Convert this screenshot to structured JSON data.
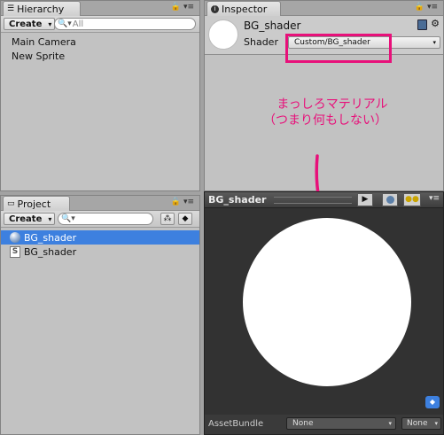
{
  "hierarchy": {
    "tab_label": "Hierarchy",
    "create_label": "Create",
    "search_placeholder": "All",
    "items": [
      "Main Camera",
      "New Sprite"
    ]
  },
  "project": {
    "tab_label": "Project",
    "create_label": "Create",
    "items": [
      {
        "label": "BG_shader",
        "icon": "material-sphere-icon",
        "selected": true
      },
      {
        "label": "BG_shader",
        "icon": "shader-file-icon",
        "selected": false
      }
    ]
  },
  "inspector": {
    "tab_label": "Inspector",
    "object_name": "BG_shader",
    "shader_label": "Shader",
    "shader_value": "Custom/BG_shader"
  },
  "annotation": {
    "line1": "まっしろマテリアル",
    "line2": "（つまり何もしない）",
    "color": "#e8107a"
  },
  "preview": {
    "title": "BG_shader",
    "assetbundle_label": "AssetBundle",
    "assetbundle_value": "None",
    "assetbundle_variant": "None"
  },
  "colors": {
    "panel": "#c2c2c2",
    "selection": "#3d80df",
    "preview_bg": "#323232",
    "annotation": "#e8107a"
  }
}
